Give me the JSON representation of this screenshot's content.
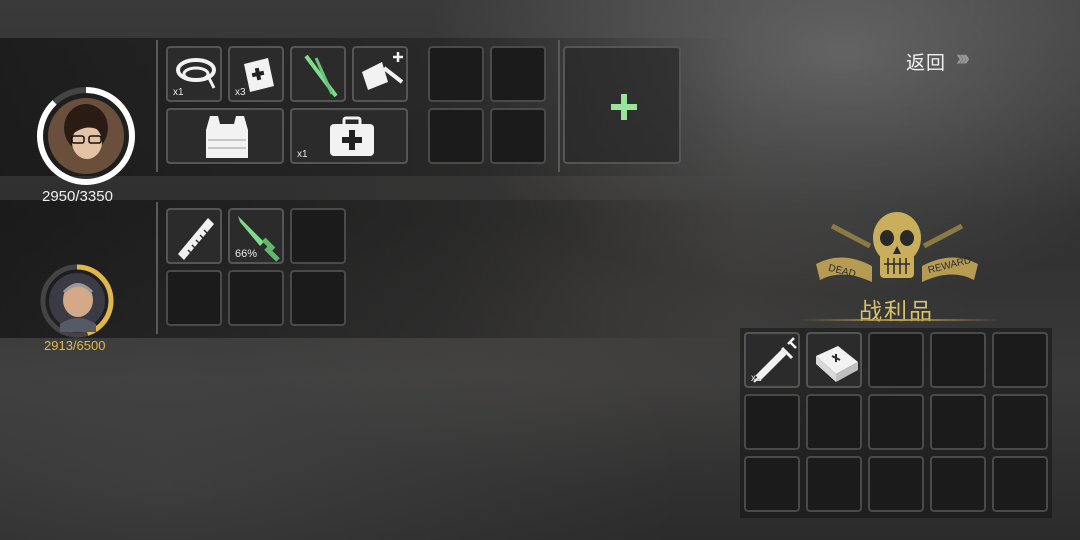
{
  "nav": {
    "back_label": "返回",
    "back_icon": "chevron-triple-right-icon"
  },
  "characters": [
    {
      "name": "female-survivor",
      "hp_text": "2950/3350",
      "hp_fraction": 0.88,
      "ring_color": "#ffffff"
    },
    {
      "name": "male-survivor",
      "hp_text": "2913/6500",
      "hp_fraction": 0.45,
      "ring_color": "#e0b84a"
    }
  ],
  "inventory_1": {
    "items": [
      {
        "icon": "bandage-icon",
        "qty": "x1"
      },
      {
        "icon": "medkit-book-icon",
        "qty": "x3"
      },
      {
        "icon": "herb-icon",
        "qty": ""
      },
      {
        "icon": "crafting-tool-icon",
        "qty": ""
      },
      {
        "icon": "body-armor-icon",
        "qty": ""
      },
      {
        "icon": "first-aid-kit-icon",
        "qty": "x1"
      }
    ],
    "add_slot_icon": "plus-icon"
  },
  "inventory_2": {
    "items": [
      {
        "icon": "comb-icon",
        "qty": ""
      },
      {
        "icon": "knife-icon",
        "durability": "66%"
      }
    ]
  },
  "loot": {
    "title": "战利品",
    "emblem_text_left": "DEAD",
    "emblem_text_right": "REWARD",
    "items": [
      {
        "icon": "syringe-icon",
        "qty": "x1"
      },
      {
        "icon": "bandage-pack-icon",
        "qty": ""
      }
    ]
  },
  "colors": {
    "accent_gold": "#d9c26e",
    "green_item": "#7fdc8e",
    "plus_green": "#9be39a"
  }
}
